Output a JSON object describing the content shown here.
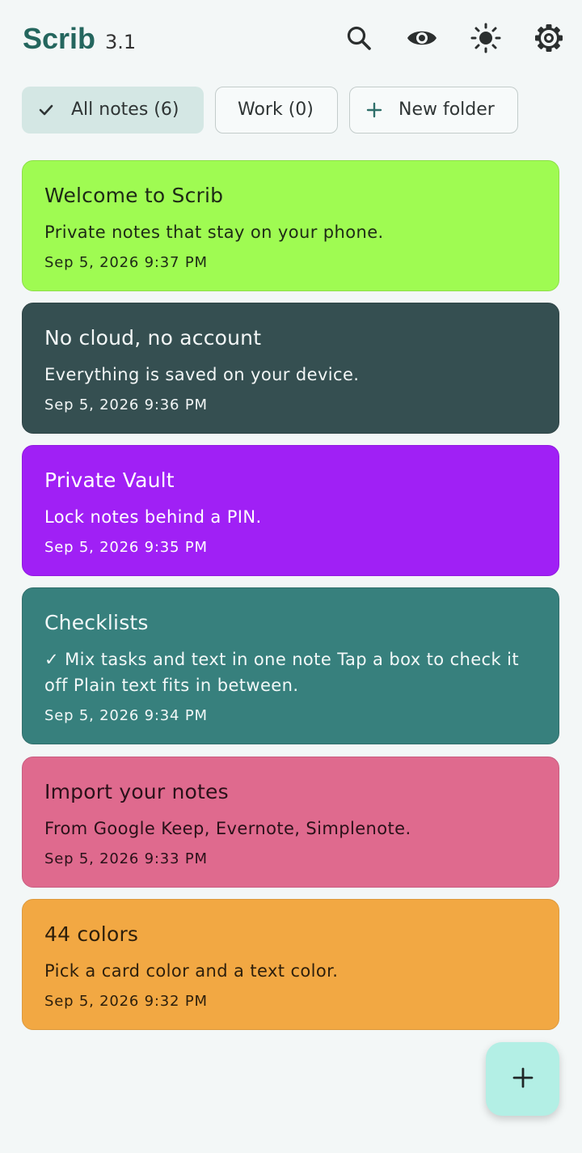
{
  "header": {
    "app_name": "Scrib",
    "version": "3.1",
    "icons": [
      "search-icon",
      "eye-icon",
      "brightness-icon",
      "settings-gear-icon"
    ]
  },
  "folders": {
    "all_notes": {
      "label": "All notes (6)",
      "icon": "check-icon",
      "selected": true
    },
    "work": {
      "label": "Work (0)",
      "selected": false
    },
    "new_folder": {
      "label": "New folder",
      "icon": "plus-icon"
    }
  },
  "notes": [
    {
      "title": "Welcome to Scrib",
      "body": "Private notes that stay on your phone.",
      "date": "Sep 5, 2026 9:37 PM",
      "bg": "#9ffb52",
      "border": "#8ede4a",
      "fg": "#1d2a16"
    },
    {
      "title": "No cloud, no account",
      "body": "Everything is saved on your device.",
      "date": "Sep 5, 2026 9:36 PM",
      "bg": "#354f51",
      "border": "#2f4446",
      "fg": "#f2f6f6"
    },
    {
      "title": "Private Vault",
      "body": "Lock notes behind a PIN.",
      "date": "Sep 5, 2026 9:35 PM",
      "bg": "#a020f5",
      "border": "#9119df",
      "fg": "#ffffff"
    },
    {
      "title": "Checklists",
      "body": "✓ Mix tasks and text in one note Tap a box to check it off Plain text fits in between.",
      "date": "Sep 5, 2026 9:34 PM",
      "bg": "#37807d",
      "border": "#316f6c",
      "fg": "#f2f8f8"
    },
    {
      "title": "Import your notes",
      "body": "From Google Keep, Evernote, Simplenote.",
      "date": "Sep 5, 2026 9:33 PM",
      "bg": "#df6a8e",
      "border": "#c95e80",
      "fg": "#2a1119"
    },
    {
      "title": "44 colors",
      "body": "Pick a card color and a text color.",
      "date": "Sep 5, 2026 9:32 PM",
      "bg": "#f2a843",
      "border": "#dd9a3e",
      "fg": "#2d1f0c"
    }
  ],
  "fab": {
    "icon": "plus-icon"
  },
  "colors": {
    "accent": "#24665e",
    "background": "#f3f7f7",
    "chip_selected": "#d4e7e4",
    "fab": "#b3efe5"
  }
}
